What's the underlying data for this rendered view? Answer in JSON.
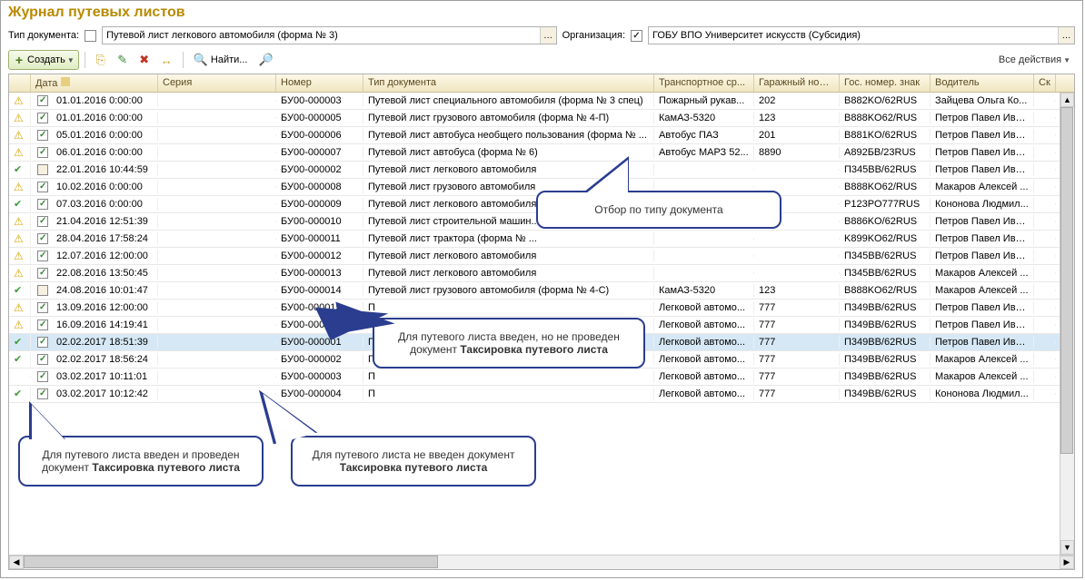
{
  "title": "Журнал путевых листов",
  "filters": {
    "docTypeLabel": "Тип документа:",
    "docTypeChecked": false,
    "docTypeValue": "Путевой лист легкового автомобиля (форма № 3)",
    "orgLabel": "Организация:",
    "orgChecked": true,
    "orgValue": "ГОБУ ВПО Университет искусств (Субсидия)"
  },
  "toolbar": {
    "createLabel": "Создать",
    "findLabel": "Найти...",
    "allActionsLabel": "Все действия"
  },
  "columns": {
    "date": "Дата",
    "series": "Серия",
    "number": "Номер",
    "doctype": "Тип документа",
    "vehicle": "Транспортное ср...",
    "garage": "Гаражный номер",
    "plate": "Гос. номер. знак",
    "driver": "Водитель",
    "sk": "Ск"
  },
  "rows": [
    {
      "status": "warn",
      "posted": true,
      "date": "01.01.2016 0:00:00",
      "number": "БУ00-000003",
      "doctype": "Путевой лист специального автомобиля (форма № 3 спец)",
      "vehicle": "Пожарный рукав...",
      "garage": "202",
      "plate": "B882KO/62RUS",
      "driver": "Зайцева Ольга Ко..."
    },
    {
      "status": "warn",
      "posted": true,
      "date": "01.01.2016 0:00:00",
      "number": "БУ00-000005",
      "doctype": "Путевой лист грузового автомобиля (форма № 4-П)",
      "vehicle": "КамАЗ-5320",
      "garage": "123",
      "plate": "B888KO62/RUS",
      "driver": "Петров Павел Ива..."
    },
    {
      "status": "warn",
      "posted": true,
      "date": "05.01.2016 0:00:00",
      "number": "БУ00-000006",
      "doctype": "Путевой лист автобуса необщего пользования (форма № ...",
      "vehicle": "Автобус ПАЗ",
      "garage": "201",
      "plate": "B881KO/62RUS",
      "driver": "Петров Павел Ива..."
    },
    {
      "status": "warn",
      "posted": true,
      "date": "06.01.2016 0:00:00",
      "number": "БУ00-000007",
      "doctype": "Путевой лист автобуса (форма № 6)",
      "vehicle": "Автобус МАРЗ 52...",
      "garage": "8890",
      "plate": "A892БВ/23RUS",
      "driver": "Петров Павел Ива..."
    },
    {
      "status": "check",
      "posted": false,
      "date": "22.01.2016 10:44:59",
      "number": "БУ00-000002",
      "doctype": "Путевой лист легкового автомобиля",
      "vehicle": "",
      "garage": "",
      "plate": "П345BB/62RUS",
      "driver": "Петров Павел Ива..."
    },
    {
      "status": "warn",
      "posted": true,
      "date": "10.02.2016 0:00:00",
      "number": "БУ00-000008",
      "doctype": "Путевой лист грузового автомобиля",
      "vehicle": "",
      "garage": "",
      "plate": "B888KO62/RUS",
      "driver": "Макаров Алексей ..."
    },
    {
      "status": "check",
      "posted": true,
      "date": "07.03.2016 0:00:00",
      "number": "БУ00-000009",
      "doctype": "Путевой лист легкового автомобиля",
      "vehicle": "",
      "garage": "",
      "plate": "P123PO777RUS",
      "driver": "Кононова Людмил..."
    },
    {
      "status": "warn",
      "posted": true,
      "date": "21.04.2016 12:51:39",
      "number": "БУ00-000010",
      "doctype": "Путевой лист строительной машин...",
      "vehicle": "",
      "garage": "",
      "plate": "B886KO/62RUS",
      "driver": "Петров Павел Ива..."
    },
    {
      "status": "warn",
      "posted": true,
      "date": "28.04.2016 17:58:24",
      "number": "БУ00-000011",
      "doctype": "Путевой лист трактора (форма № ...",
      "vehicle": "",
      "garage": "",
      "plate": "K899KO62/RUS",
      "driver": "Петров Павел Ива..."
    },
    {
      "status": "warn",
      "posted": true,
      "date": "12.07.2016 12:00:00",
      "number": "БУ00-000012",
      "doctype": "Путевой лист легкового автомобиля",
      "vehicle": "",
      "garage": "",
      "plate": "П345BB/62RUS",
      "driver": "Петров Павел Ива..."
    },
    {
      "status": "warn",
      "posted": true,
      "date": "22.08.2016 13:50:45",
      "number": "БУ00-000013",
      "doctype": "Путевой лист легкового автомобиля",
      "vehicle": "",
      "garage": "",
      "plate": "П345BB/62RUS",
      "driver": "Макаров Алексей ..."
    },
    {
      "status": "check",
      "posted": false,
      "date": "24.08.2016 10:01:47",
      "number": "БУ00-000014",
      "doctype": "Путевой лист грузового автомобиля (форма № 4-С)",
      "vehicle": "КамАЗ-5320",
      "garage": "123",
      "plate": "B888KO62/RUS",
      "driver": "Макаров Алексей ..."
    },
    {
      "status": "warn",
      "posted": true,
      "date": "13.09.2016 12:00:00",
      "number": "БУ00-000015",
      "doctype": "П",
      "vehicle": "Легковой автомо...",
      "garage": "777",
      "plate": "П349BB/62RUS",
      "driver": "Петров Павел Ива..."
    },
    {
      "status": "warn",
      "posted": true,
      "date": "16.09.2016 14:19:41",
      "number": "БУ00-000016",
      "doctype": "П",
      "vehicle": "Легковой автомо...",
      "garage": "777",
      "plate": "П349BB/62RUS",
      "driver": "Петров Павел Ива..."
    },
    {
      "status": "check",
      "posted": true,
      "date": "02.02.2017 18:51:39",
      "number": "БУ00-000001",
      "doctype": "П",
      "vehicle": "Легковой автомо...",
      "garage": "777",
      "plate": "П349BB/62RUS",
      "driver": "Петров Павел Ива...",
      "selected": true
    },
    {
      "status": "check",
      "posted": true,
      "date": "02.02.2017 18:56:24",
      "number": "БУ00-000002",
      "doctype": "П",
      "vehicle": "Легковой автомо...",
      "garage": "777",
      "plate": "П349BB/62RUS",
      "driver": "Макаров Алексей ..."
    },
    {
      "status": "",
      "posted": true,
      "date": "03.02.2017 10:11:01",
      "number": "БУ00-000003",
      "doctype": "П",
      "vehicle": "Легковой автомо...",
      "garage": "777",
      "plate": "П349BB/62RUS",
      "driver": "Макаров Алексей ..."
    },
    {
      "status": "check",
      "posted": true,
      "date": "03.02.2017 10:12:42",
      "number": "БУ00-000004",
      "doctype": "П",
      "vehicle": "Легковой автомо...",
      "garage": "777",
      "plate": "П349BB/62RUS",
      "driver": "Кононова Людмил..."
    }
  ],
  "callouts": {
    "topRight": "Отбор по типу документа",
    "mid_pre": "Для путевого листа введен, но не проведен документ ",
    "mid_bold": "Таксировка путевого листа",
    "bl_pre": "Для путевого листа введен и проведен документ ",
    "bl_bold": "Таксировка путевого листа",
    "bm_pre": "Для путевого листа не введен документ ",
    "bm_bold": "Таксировка путевого листа"
  }
}
